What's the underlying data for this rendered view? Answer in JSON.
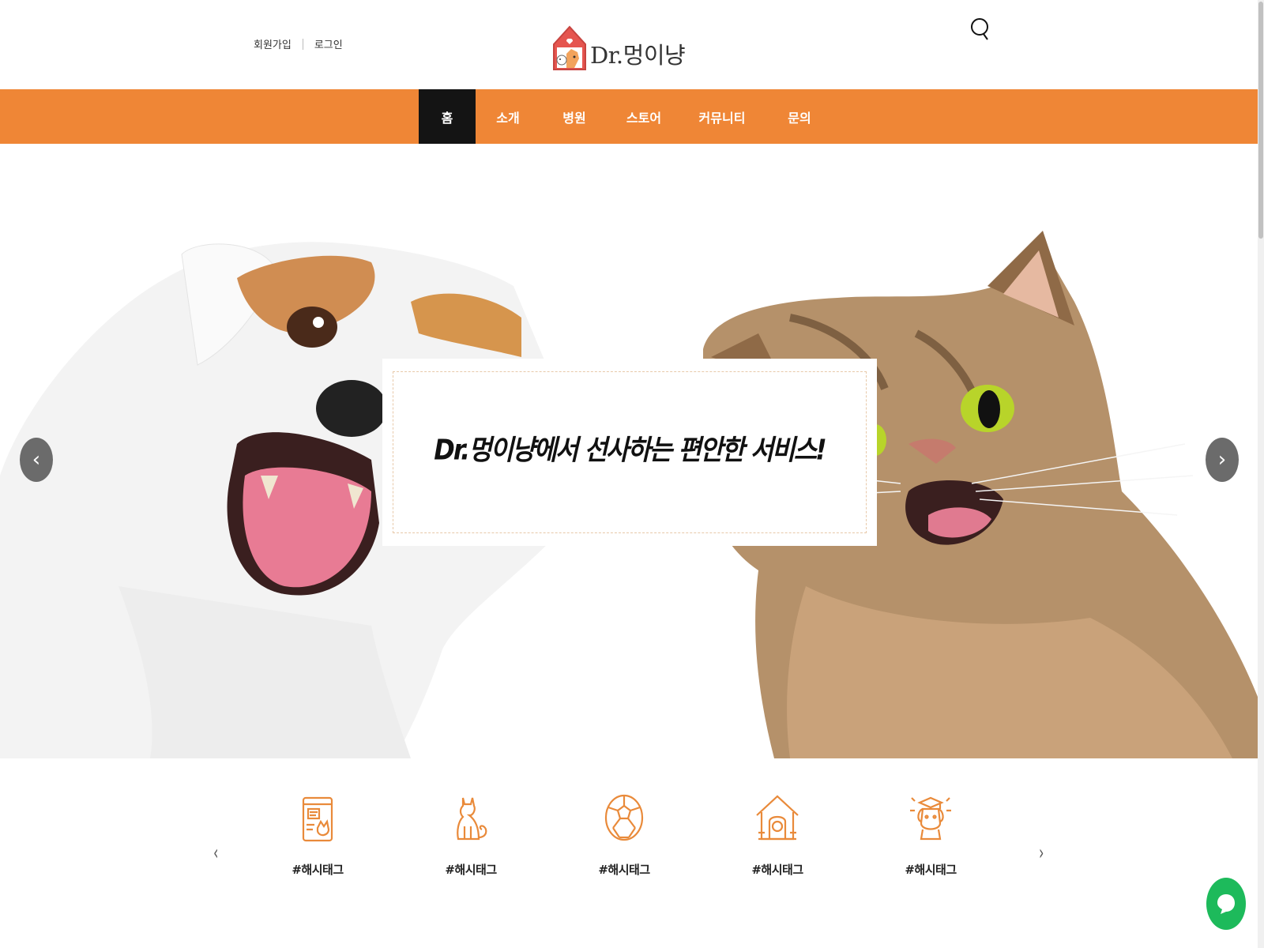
{
  "header": {
    "auth": {
      "signup": "회원가입",
      "login": "로그인"
    },
    "logo": {
      "text": "Dr.멍이냥"
    },
    "search": {
      "icon": "search-icon"
    }
  },
  "nav": {
    "items": [
      {
        "label": "홈",
        "active": true
      },
      {
        "label": "소개",
        "active": false
      },
      {
        "label": "병원",
        "active": false
      },
      {
        "label": "스토어",
        "active": false
      },
      {
        "label": "커뮤니티",
        "active": false
      },
      {
        "label": "문의",
        "active": false
      }
    ],
    "color": "#ef8636",
    "active_color": "#141414"
  },
  "hero": {
    "caption": "Dr.멍이냥에서 선사하는 편안한 서비스!",
    "prev_icon": "chevron-left-icon",
    "next_icon": "chevron-right-icon",
    "prev_glyph": "‹",
    "next_glyph": "›"
  },
  "categories": {
    "prev_glyph": "‹",
    "next_glyph": "›",
    "items": [
      {
        "icon": "pet-food-bag-icon",
        "label": "#해시태그"
      },
      {
        "icon": "cat-icon",
        "label": "#해시태그"
      },
      {
        "icon": "ball-icon",
        "label": "#해시태그"
      },
      {
        "icon": "dog-house-icon",
        "label": "#해시태그"
      },
      {
        "icon": "graduate-dog-icon",
        "label": "#해시태그"
      }
    ],
    "icon_color": "#e98a3a"
  },
  "chat": {
    "icon": "chat-bubble-icon",
    "color": "#1dba5b"
  }
}
